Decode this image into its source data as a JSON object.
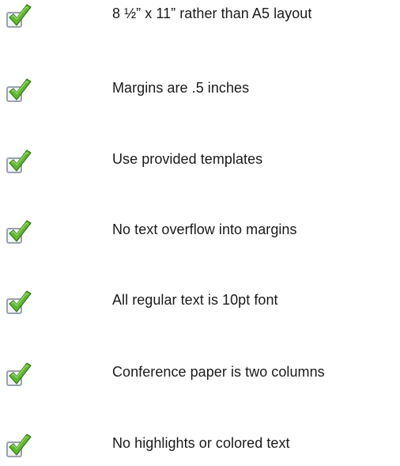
{
  "checklist": {
    "icon": "checked-box-icon",
    "colors": {
      "check_green": "#5fb82e",
      "check_outline": "#2f7a16",
      "box": "#9aa3ad",
      "text": "#1a1a1a"
    },
    "items": [
      {
        "label": "8 ½” x 11” rather than A5 layout"
      },
      {
        "label": "Margins are .5 inches"
      },
      {
        "label": "Use provided templates"
      },
      {
        "label": "No text overflow into margins"
      },
      {
        "label": "All regular text is 10pt font"
      },
      {
        "label": "Conference paper is two columns"
      },
      {
        "label": "No highlights or colored text"
      }
    ]
  }
}
